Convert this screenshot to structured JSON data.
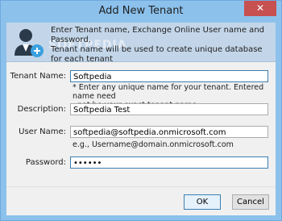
{
  "window": {
    "title": "Add New Tenant",
    "close_glyph": "✕"
  },
  "header": {
    "intro_line1": "Enter Tenant name, Exchange Online User name and Password.",
    "intro_line2": "Tenant name will be used to create unique database for each tenant",
    "icon": "user-add-icon",
    "watermark": "SOFTPEDIA"
  },
  "form": {
    "tenant_name": {
      "label": "Tenant Name:",
      "value": "Softpedia",
      "hint_line1": "* Enter any unique name for your tenant. Entered name need",
      "hint_line2": "not be your exact tenant name."
    },
    "description": {
      "label": "Description:",
      "value": "Softpedia Test"
    },
    "user_name": {
      "label": "User Name:",
      "value": "softpedia@softpedia.onmicrosoft.com",
      "hint": "e.g., Username@domain.onmicrosoft.com"
    },
    "password": {
      "label": "Password:",
      "value": "••••••"
    }
  },
  "buttons": {
    "ok": "OK",
    "cancel": "Cancel"
  }
}
